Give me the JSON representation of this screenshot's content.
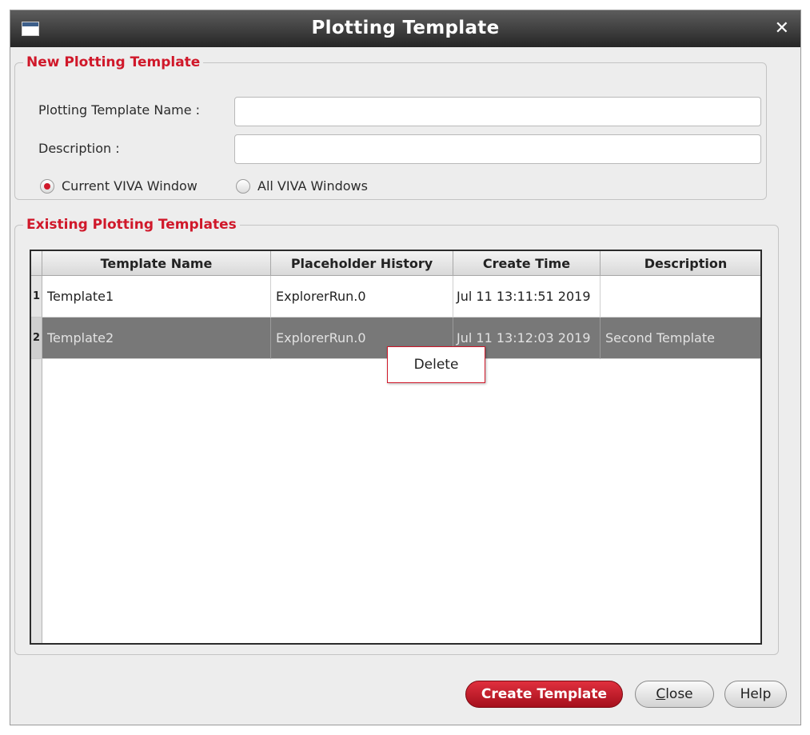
{
  "window": {
    "title": "Plotting Template"
  },
  "new_section": {
    "legend": "New Plotting Template",
    "name_label": "Plotting Template Name :",
    "name_value": "",
    "description_label": "Description :",
    "description_value": "",
    "radio_current": "Current VIVA Window",
    "radio_all": "All VIVA Windows",
    "selected_radio": "current"
  },
  "existing_section": {
    "legend": "Existing Plotting Templates",
    "columns": [
      "Template Name",
      "Placeholder History",
      "Create Time",
      "Description"
    ],
    "rows": [
      {
        "num": "1",
        "name": "Template1",
        "history": "ExplorerRun.0",
        "time": "Jul 11 13:11:51 2019",
        "description": ""
      },
      {
        "num": "2",
        "name": "Template2",
        "history": "ExplorerRun.0",
        "time": "Jul 11 13:12:03 2019",
        "description": "Second Template"
      }
    ],
    "selected_row": 2
  },
  "context_menu": {
    "delete_label": "Delete"
  },
  "buttons": {
    "create": "Create Template",
    "close_mnemonic": "C",
    "close_rest": "lose",
    "help": "Help"
  },
  "colors": {
    "accent_red": "#d0182a",
    "selected_row": "#787878",
    "titlebar": "#262626"
  }
}
